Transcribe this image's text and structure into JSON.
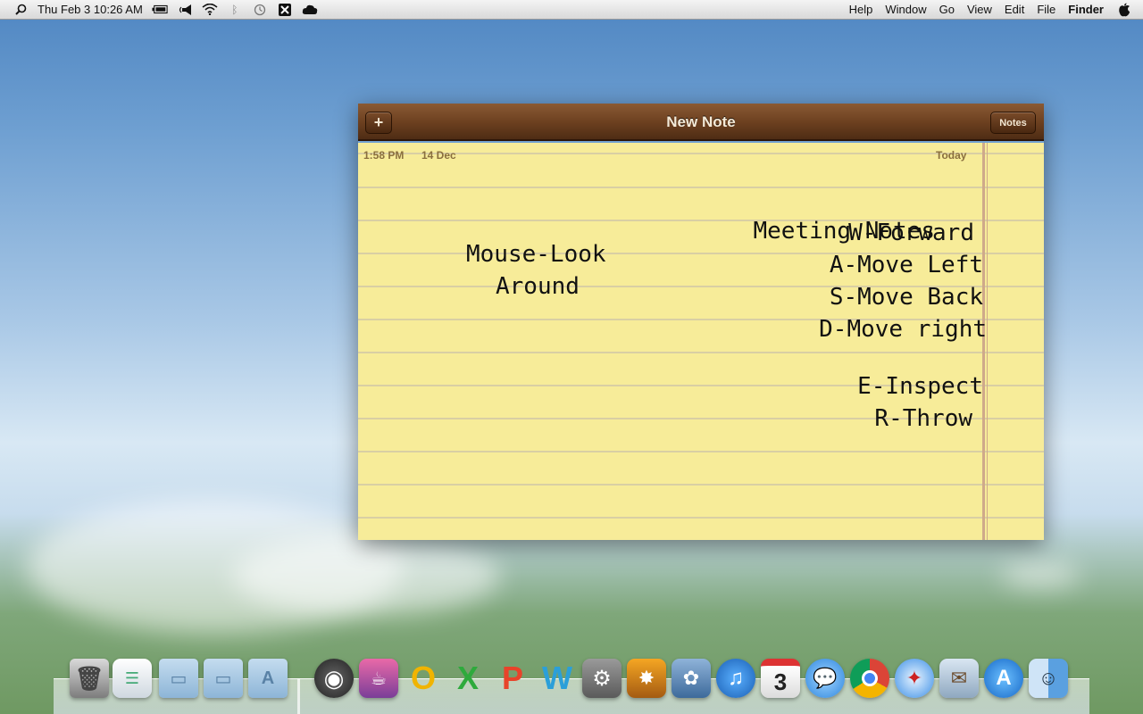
{
  "menubar": {
    "apple_icon": "apple-icon",
    "app_name": "Finder",
    "menus": [
      "File",
      "Edit",
      "View",
      "Go",
      "Window",
      "Help"
    ],
    "clock": "Thu Feb 3  10:26 AM",
    "status_icons": [
      "dropbox-icon",
      "x-app-icon",
      "time-machine-icon",
      "bluetooth-icon",
      "wifi-icon",
      "volume-icon",
      "battery-icon"
    ],
    "spotlight_icon": "spotlight-search-icon"
  },
  "notes_window": {
    "title": "New Note",
    "add_button": "+",
    "notes_button": "Notes",
    "today_label": "Today",
    "date_label": "14 Dec",
    "time_label": "1:58 PM",
    "lines": {
      "heading": "Meeting Notes",
      "w": "W-Forward",
      "a": "A-Move Left",
      "s": "S-Move Back",
      "d": "D-Move right",
      "mouse_1": "Mouse-Look",
      "mouse_2": "Around",
      "e": "E-Inspect",
      "r": "R-Throw"
    }
  },
  "dock": {
    "icons": [
      "trash-icon",
      "preview-doc-icon",
      "documents-folder-icon",
      "downloads-folder-icon",
      "applications-folder-icon",
      "alfred-icon",
      "photo-booth-icon",
      "outlook-icon",
      "excel-icon",
      "powerpoint-icon",
      "word-icon",
      "system-preferences-icon",
      "photo-app-icon",
      "iphoto-icon",
      "itunes-icon",
      "ical-icon",
      "ichat-icon",
      "chrome-icon",
      "safari-icon",
      "mail-icon",
      "app-store-icon",
      "finder-icon"
    ],
    "ical_day": "3"
  }
}
